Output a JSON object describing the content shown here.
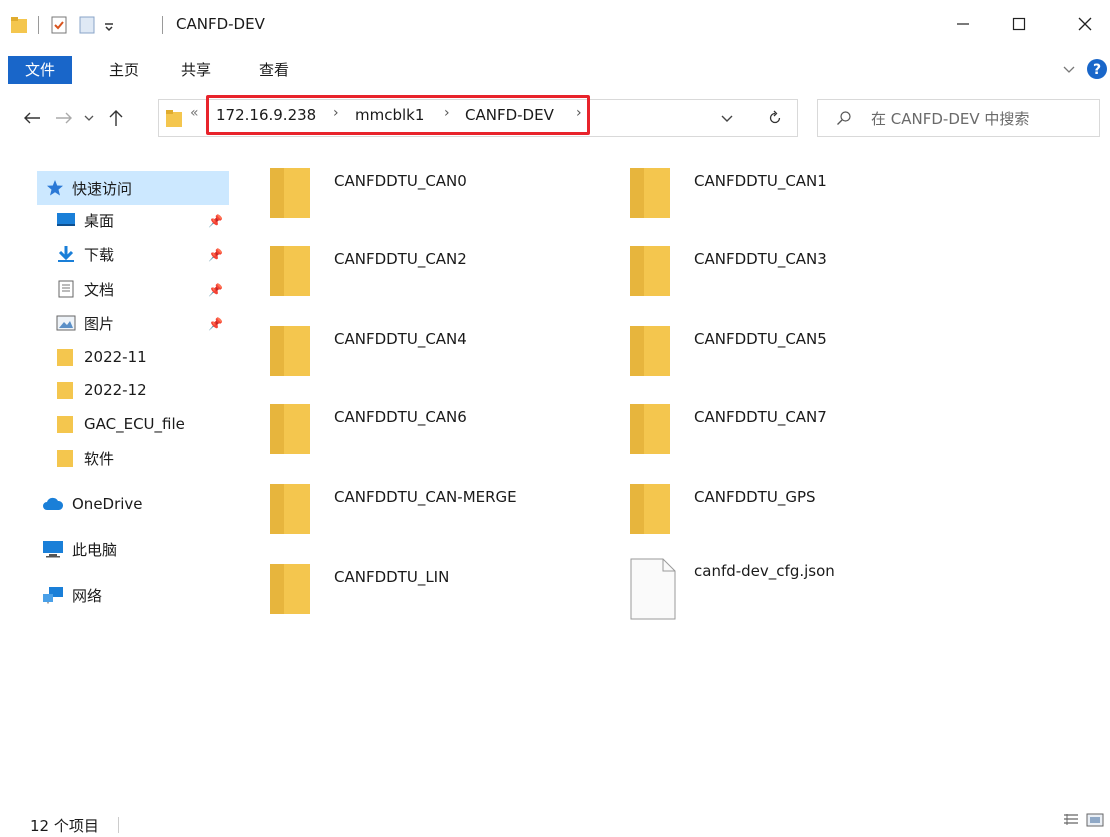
{
  "window": {
    "title": "CANFD-DEV",
    "minimize": "—",
    "maximize": "☐",
    "close": "✕"
  },
  "ribbon": {
    "tabs": [
      {
        "label": "文件"
      },
      {
        "label": "主页"
      },
      {
        "label": "共享"
      },
      {
        "label": "查看"
      }
    ]
  },
  "nav": {
    "overflow": "«",
    "breadcrumbs": [
      {
        "label": "172.16.9.238"
      },
      {
        "label": "mmcblk1"
      },
      {
        "label": "CANFD-DEV"
      }
    ],
    "search_placeholder": "在 CANFD-DEV 中搜索"
  },
  "sidebar": {
    "items": [
      {
        "label": "快速访问",
        "icon": "star-icon"
      },
      {
        "label": "桌面",
        "icon": "desktop-icon",
        "pinned": true
      },
      {
        "label": "下载",
        "icon": "download-icon",
        "pinned": true
      },
      {
        "label": "文档",
        "icon": "document-icon",
        "pinned": true
      },
      {
        "label": "图片",
        "icon": "pictures-icon",
        "pinned": true
      },
      {
        "label": "2022-11",
        "icon": "folder-icon"
      },
      {
        "label": "2022-12",
        "icon": "folder-icon"
      },
      {
        "label": "GAC_ECU_file",
        "icon": "folder-icon"
      },
      {
        "label": "软件",
        "icon": "folder-icon"
      },
      {
        "label": "OneDrive",
        "icon": "cloud-icon"
      },
      {
        "label": "此电脑",
        "icon": "computer-icon"
      },
      {
        "label": "网络",
        "icon": "network-icon"
      }
    ]
  },
  "files": [
    {
      "name": "CANFDDTU_CAN0",
      "type": "folder"
    },
    {
      "name": "CANFDDTU_CAN1",
      "type": "folder"
    },
    {
      "name": "CANFDDTU_CAN2",
      "type": "folder"
    },
    {
      "name": "CANFDDTU_CAN3",
      "type": "folder"
    },
    {
      "name": "CANFDDTU_CAN4",
      "type": "folder"
    },
    {
      "name": "CANFDDTU_CAN5",
      "type": "folder"
    },
    {
      "name": "CANFDDTU_CAN6",
      "type": "folder"
    },
    {
      "name": "CANFDDTU_CAN7",
      "type": "folder"
    },
    {
      "name": "CANFDDTU_CAN-MERGE",
      "type": "folder"
    },
    {
      "name": "CANFDDTU_GPS",
      "type": "folder"
    },
    {
      "name": "CANFDDTU_LIN",
      "type": "folder"
    },
    {
      "name": "canfd-dev_cfg.json",
      "type": "file"
    }
  ],
  "status": {
    "count": "12 个项目"
  },
  "colors": {
    "accent": "#1966c9",
    "selection": "#cce8ff",
    "folder": "#f4c64e",
    "highlight_box": "#e8232b"
  }
}
